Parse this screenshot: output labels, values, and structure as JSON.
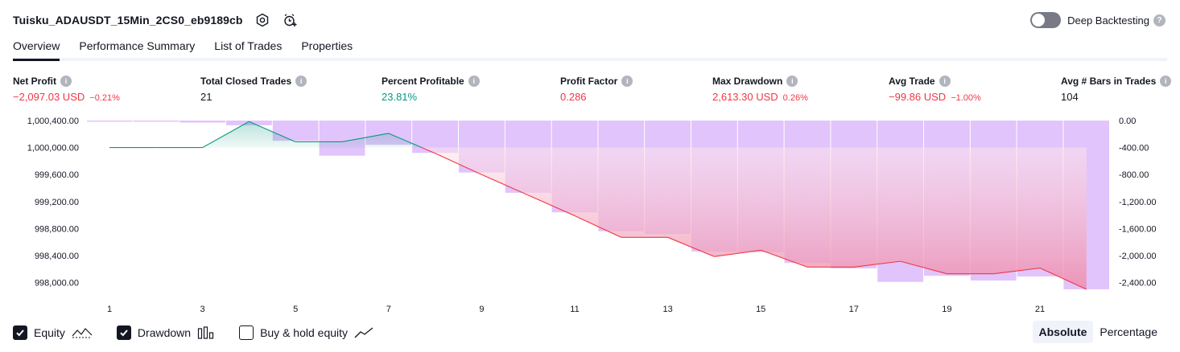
{
  "strategy_title": "Tuisku_ADAUSDT_15Min_2CS0_eb9189cb",
  "deep_backtesting": {
    "label": "Deep Backtesting",
    "enabled": false,
    "help": "?"
  },
  "tabs": [
    {
      "label": "Overview",
      "active": true
    },
    {
      "label": "Performance Summary",
      "active": false
    },
    {
      "label": "List of Trades",
      "active": false
    },
    {
      "label": "Properties",
      "active": false
    }
  ],
  "metrics": [
    {
      "label": "Net Profit",
      "value": "−2,097.03 USD",
      "pct": "−0.21%",
      "tone": "neg"
    },
    {
      "label": "Total Closed Trades",
      "value": "21",
      "pct": "",
      "tone": "neu"
    },
    {
      "label": "Percent Profitable",
      "value": "23.81%",
      "pct": "",
      "tone": "pos"
    },
    {
      "label": "Profit Factor",
      "value": "0.286",
      "pct": "",
      "tone": "neg"
    },
    {
      "label": "Max Drawdown",
      "value": "2,613.30 USD",
      "pct": "0.26%",
      "tone": "neg"
    },
    {
      "label": "Avg Trade",
      "value": "−99.86 USD",
      "pct": "−1.00%",
      "tone": "neg"
    },
    {
      "label": "Avg # Bars in Trades",
      "value": "104",
      "pct": "",
      "tone": "neu"
    }
  ],
  "chart_data": {
    "type": "line",
    "x_ticks": [
      "1",
      "3",
      "5",
      "7",
      "9",
      "11",
      "13",
      "15",
      "17",
      "19",
      "21"
    ],
    "left_axis": {
      "ticks": [
        "1,000,400.00",
        "1,000,000.00",
        "999,600.00",
        "999,200.00",
        "998,800.00",
        "998,400.00",
        "998,000.00"
      ],
      "ylim": [
        997900,
        1000400
      ]
    },
    "right_axis": {
      "ticks": [
        "0.00",
        "-400.00",
        "-800.00",
        "-1,200.00",
        "-1,600.00",
        "-2,000.00",
        "-2,400.00"
      ],
      "ylim": [
        -2500,
        0
      ]
    },
    "equity": {
      "name": "Equity",
      "x": [
        1,
        2,
        3,
        4,
        5,
        6,
        7,
        8,
        9,
        10,
        11,
        12,
        13,
        14,
        15,
        16,
        17,
        18,
        19,
        20,
        21,
        22
      ],
      "values": [
        1000000,
        1000000,
        1000000,
        1000385,
        1000085,
        1000085,
        1000210,
        999915,
        999600,
        999295,
        998990,
        998670,
        998670,
        998385,
        998480,
        998230,
        998230,
        998315,
        998130,
        998130,
        998215,
        997900
      ]
    },
    "drawdown": {
      "name": "Drawdown",
      "x": [
        1,
        2,
        3,
        4,
        5,
        6,
        7,
        8,
        9,
        10,
        11,
        12,
        13,
        14,
        15,
        16,
        17,
        18,
        19,
        20,
        21,
        22
      ],
      "values": [
        0,
        -15,
        -30,
        -70,
        -300,
        -520,
        -360,
        -480,
        -770,
        -1070,
        -1360,
        -1640,
        -1680,
        -1940,
        -1950,
        -2110,
        -2190,
        -2390,
        -2300,
        -2370,
        -2310,
        -2500
      ]
    },
    "colors": {
      "equity_up": "#089981",
      "equity_down": "#f23645",
      "drawdown_bar": "#e1c4fb",
      "fill_down_top": "#fce4ec",
      "fill_down_bottom": "#ee8cac",
      "fill_up": "#d3efe9"
    }
  },
  "footer": {
    "checkboxes": [
      {
        "label": "Equity",
        "checked": true,
        "icon": "equity-line-icon"
      },
      {
        "label": "Drawdown",
        "checked": true,
        "icon": "drawdown-bars-icon"
      },
      {
        "label": "Buy & hold equity",
        "checked": false,
        "icon": "buy-hold-line-icon"
      }
    ],
    "modes": [
      {
        "label": "Absolute",
        "active": true
      },
      {
        "label": "Percentage",
        "active": false
      }
    ]
  }
}
